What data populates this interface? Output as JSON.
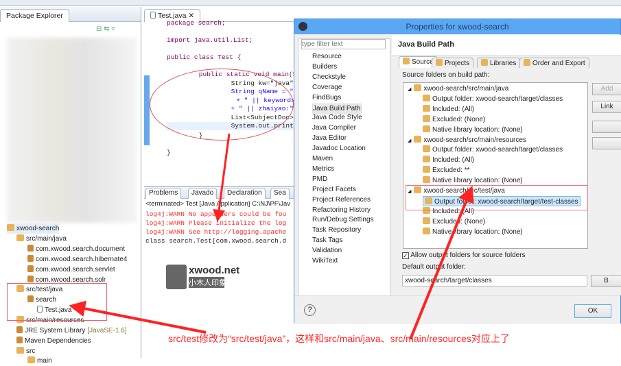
{
  "package_explorer": {
    "title": "Package Explorer",
    "items": [
      {
        "label": "xwood-search",
        "icon": "project-icon",
        "depth": 0
      },
      {
        "label": "src/main/java",
        "icon": "source-folder-icon",
        "depth": 1
      },
      {
        "label": "com.xwood.search.document",
        "icon": "package-icon",
        "depth": 2
      },
      {
        "label": "com.xwood.search.hibernate4",
        "icon": "package-icon",
        "depth": 2
      },
      {
        "label": "com.xwood.search.servlet",
        "icon": "package-icon",
        "depth": 2
      },
      {
        "label": "com.xwood.search.solr",
        "icon": "package-icon",
        "depth": 2
      },
      {
        "label": "src/test/java",
        "icon": "source-folder-icon",
        "depth": 1
      },
      {
        "label": "search",
        "icon": "package-icon",
        "depth": 2
      },
      {
        "label": "Test.java",
        "icon": "java-file-icon",
        "depth": 3
      },
      {
        "label": "src/main/resources",
        "icon": "source-folder-icon",
        "depth": 1
      },
      {
        "label": "JRE System Library",
        "suffix": "[JavaSE-1.6]",
        "icon": "library-icon",
        "depth": 1
      },
      {
        "label": "Maven Dependencies",
        "icon": "library-icon",
        "depth": 1
      },
      {
        "label": "src",
        "icon": "folder-icon",
        "depth": 1
      },
      {
        "label": "main",
        "icon": "folder-icon",
        "depth": 2
      }
    ]
  },
  "editor": {
    "tab": "Test.java",
    "lines": [
      "package search;",
      "import java.util.List;",
      "public class Test {",
      "    public static void main(Str",
      "        String kw=\"java\";",
      "        String qName = \"title:\"",
      "         + \" || keywords:\"+Text",
      "        + \" || zhaiyao:\"+TextEs",
      "        List<SubjectDoc> ss= Sc",
      "        System.out.println(Test",
      "    }",
      "}"
    ]
  },
  "console": {
    "tabs": [
      "Problems",
      "Javado",
      "Declaration",
      "Sea"
    ],
    "status": "<terminated> Test [Java Application] C:\\NJ\\PF\\Jav",
    "lines": [
      "log4j:WARN No appenders could be fou",
      "log4j:WARN Please initialize the log",
      "log4j:WARN See http://logging.apache",
      "class search.Test[com.xwood.search.d"
    ]
  },
  "watermark": {
    "brand": "xwood.net",
    "subtitle": "小木人印象"
  },
  "dialog": {
    "title": "Properties for xwood-search",
    "filter_placeholder": "type filter text",
    "nav": [
      "Resource",
      "Builders",
      "Checkstyle",
      "Coverage",
      "FindBugs",
      "Java Build Path",
      "Java Code Style",
      "Java Compiler",
      "Java Editor",
      "Javadoc Location",
      "Maven",
      "Metrics",
      "PMD",
      "Project Facets",
      "Project References",
      "Refactoring History",
      "Run/Debug Settings",
      "Task Repository",
      "Task Tags",
      "Validation",
      "WikiText"
    ],
    "selected_nav": "Java Build Path",
    "page_title": "Java Build Path",
    "tabs": [
      "Source",
      "Projects",
      "Libraries",
      "Order and Export"
    ],
    "source_label": "Source folders on build path:",
    "tree": [
      {
        "label": "xwood-search/src/main/java",
        "level": 0
      },
      {
        "label": "Output folder: xwood-search/target/classes",
        "level": 1
      },
      {
        "label": "Included: (All)",
        "level": 1
      },
      {
        "label": "Excluded: (None)",
        "level": 1
      },
      {
        "label": "Native library location: (None)",
        "level": 1
      },
      {
        "label": "xwood-search/src/main/resources",
        "level": 0
      },
      {
        "label": "Output folder: xwood-search/target/classes",
        "level": 1
      },
      {
        "label": "Included: (All)",
        "level": 1
      },
      {
        "label": "Excluded: **",
        "level": 1
      },
      {
        "label": "Native library location: (None)",
        "level": 1
      },
      {
        "label": "xwood-search/src/test/java",
        "level": 0
      },
      {
        "label": "Output folder: xwood-search/target/test-classes",
        "level": 1,
        "selected": true
      },
      {
        "label": "Included: (All)",
        "level": 1
      },
      {
        "label": "Excluded: (None)",
        "level": 1
      },
      {
        "label": "Native library location: (None)",
        "level": 1
      }
    ],
    "side_buttons": [
      "Add",
      "Link",
      "",
      ""
    ],
    "allow_output_label": "Allow output folders for source folders",
    "allow_output_checked": true,
    "default_output_label": "Default output folder:",
    "default_output_value": "xwood-search/target/classes",
    "browse_label": "B",
    "ok_label": "OK"
  },
  "annotation": "src/test修改为“src/test/java”，这样和src/main/java、src/main/resources对应上了",
  "colors": {
    "accent": "#5aa7f3",
    "annotation": "#ff2a2a",
    "selection": "#cde8ff"
  }
}
